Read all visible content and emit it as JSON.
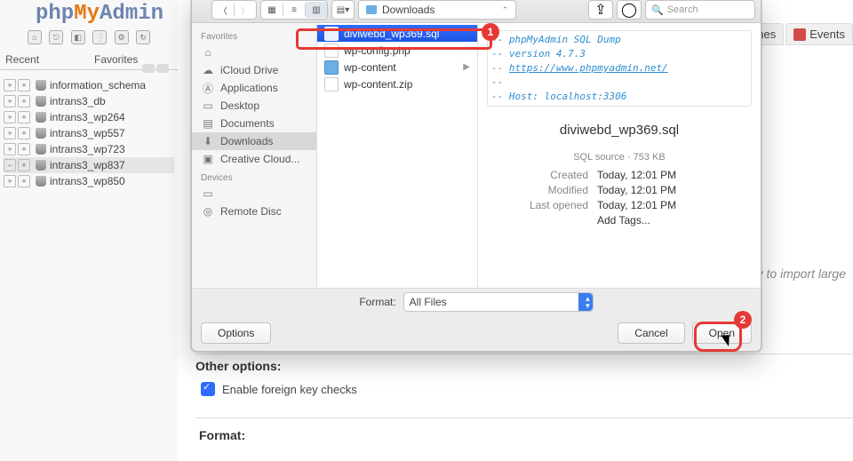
{
  "pma": {
    "logo": {
      "p1": "php",
      "p2": "My",
      "p3": "Admin"
    },
    "tabs": {
      "recent": "Recent",
      "favorites": "Favorites"
    },
    "tree": [
      {
        "label": "information_schema",
        "selected": false,
        "minus": false
      },
      {
        "label": "intrans3_db",
        "selected": false,
        "minus": false
      },
      {
        "label": "intrans3_wp264",
        "selected": false,
        "minus": false
      },
      {
        "label": "intrans3_wp557",
        "selected": false,
        "minus": false
      },
      {
        "label": "intrans3_wp723",
        "selected": false,
        "minus": false
      },
      {
        "label": "intrans3_wp837",
        "selected": true,
        "minus": true
      },
      {
        "label": "intrans3_wp850",
        "selected": false,
        "minus": false
      }
    ],
    "nav": {
      "routines": "utines",
      "events": "Events"
    },
    "hint": "od way to import large",
    "other_options": "Other options:",
    "enable_fkc": "Enable foreign key checks",
    "format_label": "Format:"
  },
  "dlg": {
    "path": "Downloads",
    "search_placeholder": "Search",
    "sidebar": {
      "favorites": "Favorites",
      "devices": "Devices",
      "items": [
        {
          "label": "",
          "icon": "home"
        },
        {
          "label": "iCloud Drive",
          "icon": "cloud"
        },
        {
          "label": "Applications",
          "icon": "apps"
        },
        {
          "label": "Desktop",
          "icon": "desktop"
        },
        {
          "label": "Documents",
          "icon": "docs"
        },
        {
          "label": "Downloads",
          "icon": "down",
          "selected": true
        },
        {
          "label": "Creative Cloud...",
          "icon": "folder"
        }
      ],
      "devices_items": [
        {
          "label": "",
          "icon": "mac"
        },
        {
          "label": "Remote Disc",
          "icon": "disc"
        }
      ]
    },
    "files": [
      {
        "label": "diviwebd_wp369.sql",
        "type": "file",
        "selected": true
      },
      {
        "label": "wp-config.php",
        "type": "file"
      },
      {
        "label": "wp-content",
        "type": "folder"
      },
      {
        "label": "wp-content.zip",
        "type": "file"
      }
    ],
    "preview": {
      "comment_lines": [
        "-- phpMyAdmin SQL Dump",
        "-- version 4.7.3",
        "-- https://www.phpmyadmin.net/",
        "--",
        "-- Host: localhost:3306"
      ],
      "title": "diviwebd_wp369.sql",
      "source": "SQL source · 753 KB",
      "created_k": "Created",
      "created_v": "Today, 12:01 PM",
      "modified_k": "Modified",
      "modified_v": "Today, 12:01 PM",
      "opened_k": "Last opened",
      "opened_v": "Today, 12:01 PM",
      "tags": "Add Tags..."
    },
    "format_label": "Format:",
    "format_value": "All Files",
    "options": "Options",
    "cancel": "Cancel",
    "open": "Open"
  },
  "badges": {
    "one": "1",
    "two": "2"
  }
}
